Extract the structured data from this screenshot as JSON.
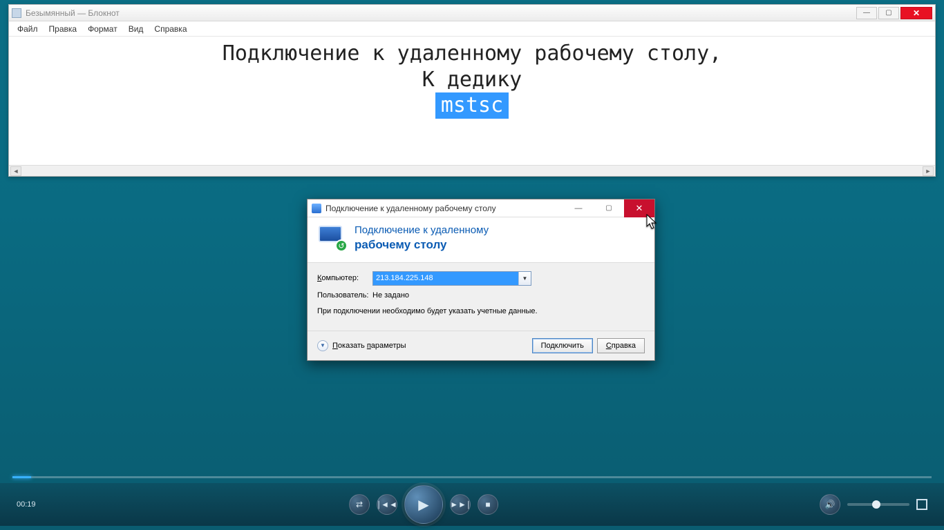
{
  "notepad": {
    "title": "Безымянный — Блокнот",
    "menu": [
      "Файл",
      "Правка",
      "Формат",
      "Вид",
      "Справка"
    ],
    "line1": "Подключение к удаленному рабочему столу,",
    "line2": "К дедику",
    "line3_selected": "mstsc"
  },
  "rdp": {
    "window_title": "Подключение к удаленному рабочему столу",
    "header_line1": "Подключение к удаленному",
    "header_line2": "рабочему столу",
    "computer_label": "Компьютер:",
    "computer_value": "213.184.225.148",
    "user_label": "Пользователь:",
    "user_value": "Не задано",
    "note": "При подключении необходимо будет указать учетные данные.",
    "show_options": "Показать параметры",
    "connect": "Подключить",
    "help": "Справка"
  },
  "player": {
    "time": "00:19"
  }
}
